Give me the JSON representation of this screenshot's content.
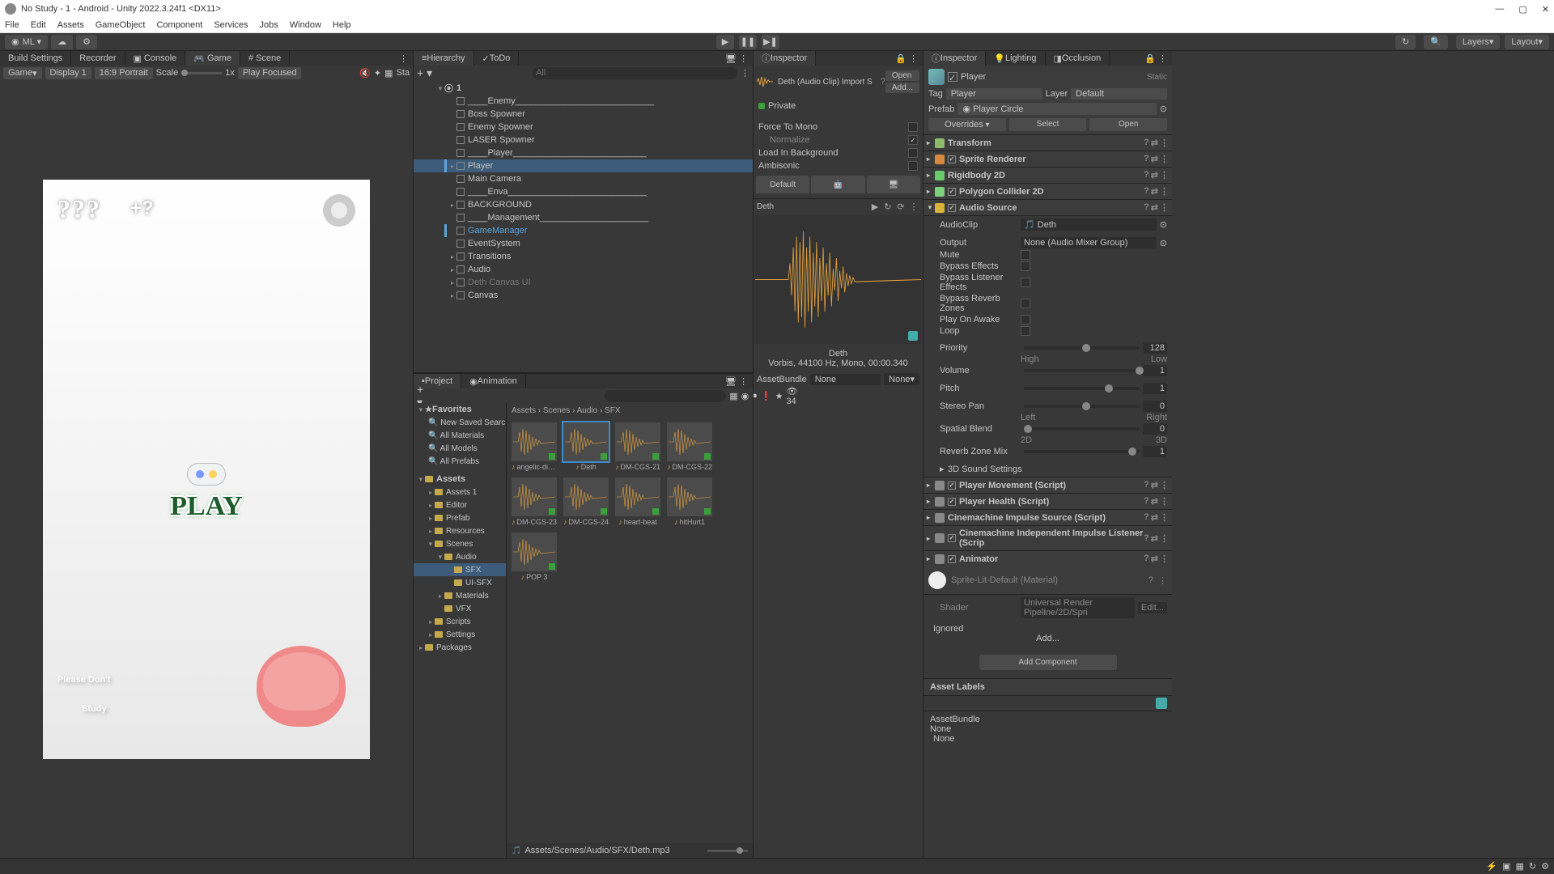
{
  "title": "No Study - 1 - Android - Unity 2022.3.24f1 <DX11>",
  "menu": [
    "File",
    "Edit",
    "Assets",
    "GameObject",
    "Component",
    "Services",
    "Jobs",
    "Window",
    "Help"
  ],
  "toolbar": {
    "account": "ML ▾",
    "layers": "Layers",
    "layout": "Layout"
  },
  "tabs_left": {
    "build": "Build Settings",
    "recorder": "Recorder",
    "console": "Console",
    "game": "Game",
    "scene": "Scene"
  },
  "game_bar": {
    "game": "Game",
    "display": "Display 1",
    "aspect": "16:9 Portrait",
    "scale_label": "Scale",
    "scale_val": "1x",
    "playfocused": "Play Focused",
    "stats": "Sta"
  },
  "game_overlay": {
    "question": "???",
    "plus": "+?",
    "play": "PLAY",
    "tag1": "Please Don't",
    "tag2": "Study"
  },
  "hierarchy": {
    "tab_h": "Hierarchy",
    "tab_todo": "ToDo",
    "search_ph": "All",
    "scene": "1",
    "items": [
      {
        "name": "____Enemy____________________________",
        "indent": 1
      },
      {
        "name": "Boss Spowner",
        "indent": 1
      },
      {
        "name": "Enemy Spowner",
        "indent": 1
      },
      {
        "name": "LASER Spowner",
        "indent": 1
      },
      {
        "name": "____Player___________________________",
        "indent": 1
      },
      {
        "name": "Player",
        "indent": 1,
        "sel": true,
        "arrow": true,
        "bar": true
      },
      {
        "name": "Main Camera",
        "indent": 1
      },
      {
        "name": "____Enva____________________________",
        "indent": 1
      },
      {
        "name": "BACKGROUND",
        "indent": 1,
        "arrow": true
      },
      {
        "name": "____Management______________________",
        "indent": 1
      },
      {
        "name": "GameManager",
        "indent": 1,
        "highlight": true,
        "bar": true
      },
      {
        "name": "EventSystem",
        "indent": 1
      },
      {
        "name": "Transitions",
        "indent": 1,
        "arrow": true
      },
      {
        "name": "Audio",
        "indent": 1,
        "arrow": true
      },
      {
        "name": "Deth Canvas UI",
        "indent": 1,
        "arrow": true,
        "dim": true
      },
      {
        "name": "Canvas",
        "indent": 1,
        "arrow": true
      }
    ]
  },
  "audioimport": {
    "tab": "Inspector",
    "title": "Deth (Audio Clip) Import S",
    "open": "Open",
    "add": "Add...",
    "private": "Private",
    "force": "Force To Mono",
    "normalize": "Normalize",
    "loadbg": "Load In Background",
    "ambisonic": "Ambisonic",
    "default": "Default",
    "preview_name": "Deth",
    "info_name": "Deth",
    "info_fmt": "Vorbis, 44100 Hz, Mono, 00:00.340",
    "ab_label": "AssetBundle",
    "ab_none": "None",
    "ab_none2": "None▾"
  },
  "inspector": {
    "tab_i": "Inspector",
    "tab_l": "Lighting",
    "tab_o": "Occlusion",
    "name": "Player",
    "static": "Static",
    "tag_label": "Tag",
    "tag": "Player",
    "layer_label": "Layer",
    "layer": "Default",
    "prefab_label": "Prefab",
    "prefab": "Player Circle",
    "overrides": "Overrides",
    "select": "Select",
    "openp": "Open",
    "comps": [
      {
        "name": "Transform",
        "color": "#8fb96b"
      },
      {
        "name": "Sprite Renderer",
        "color": "#d8883a",
        "check": true
      },
      {
        "name": "Rigidbody 2D",
        "color": "#6aca6a"
      },
      {
        "name": "Polygon Collider 2D",
        "color": "#7dd07d",
        "check": true
      },
      {
        "name": "Audio Source",
        "color": "#d8b33a",
        "check": true,
        "open": true
      }
    ],
    "audio": {
      "clip_label": "AudioClip",
      "clip": "Deth",
      "output_label": "Output",
      "output": "None (Audio Mixer Group)",
      "mute": "Mute",
      "bypass_fx": "Bypass Effects",
      "bypass_lfx": "Bypass Listener Effects",
      "bypass_rz": "Bypass Reverb Zones",
      "play_awake": "Play On Awake",
      "loop": "Loop",
      "priority_label": "Priority",
      "priority": "128",
      "priority_lo": "High",
      "priority_hi": "Low",
      "volume_label": "Volume",
      "volume": "1",
      "pitch_label": "Pitch",
      "pitch": "1",
      "stereo_label": "Stereo Pan",
      "stereo": "0",
      "stereo_lo": "Left",
      "stereo_hi": "Right",
      "spatial_label": "Spatial Blend",
      "spatial": "0",
      "spatial_lo": "2D",
      "spatial_hi": "3D",
      "reverb_label": "Reverb Zone Mix",
      "reverb": "1",
      "d3": "3D Sound Settings"
    },
    "comps2": [
      {
        "name": "Player Movement (Script)",
        "check": true
      },
      {
        "name": "Player Health (Script)",
        "check": true
      },
      {
        "name": "Cinemachine Impulse Source (Script)"
      },
      {
        "name": "Cinemachine Independent Impulse Listener (Scrip",
        "check": true
      },
      {
        "name": "Animator",
        "check": true
      }
    ],
    "material": "Sprite-Lit-Default (Material)",
    "shader_label": "Shader",
    "shader": "Universal Render Pipeline/2D/Spri",
    "edit": "Edit...",
    "ignored": "Ignored",
    "addbtn": "Add...",
    "addcomp": "Add Component",
    "asset_labels": "Asset Labels",
    "ab_label": "AssetBundle",
    "ab_none": "None",
    "ab_none2": "None"
  },
  "project": {
    "tab_p": "Project",
    "tab_a": "Animation",
    "count": "34",
    "favorites": "Favorites",
    "fav_items": [
      "New Saved Searc",
      "All Materials",
      "All Models",
      "All Prefabs"
    ],
    "assets": "Assets",
    "tree": [
      {
        "name": "Assets 1",
        "indent": 1,
        "arrow": true
      },
      {
        "name": "Editor",
        "indent": 1,
        "arrow": true
      },
      {
        "name": "Prefab",
        "indent": 1,
        "arrow": true
      },
      {
        "name": "Resources",
        "indent": 1,
        "arrow": true
      },
      {
        "name": "Scenes",
        "indent": 1,
        "arrow": true,
        "open": true
      },
      {
        "name": "Audio",
        "indent": 2,
        "arrow": true,
        "open": true
      },
      {
        "name": "SFX",
        "indent": 3,
        "sel": true
      },
      {
        "name": "UI-SFX",
        "indent": 3
      },
      {
        "name": "Materials",
        "indent": 2,
        "arrow": true
      },
      {
        "name": "VFX",
        "indent": 2
      },
      {
        "name": "Scripts",
        "indent": 1,
        "arrow": true
      },
      {
        "name": "Settings",
        "indent": 1,
        "arrow": true
      },
      {
        "name": "Packages",
        "indent": 0,
        "arrow": true
      }
    ],
    "breadcrumb": "Assets  ›  Scenes  ›  Audio  ›  SFX",
    "assets_list": [
      {
        "name": "angelic-dis..."
      },
      {
        "name": "Deth",
        "sel": true
      },
      {
        "name": "DM-CGS-21"
      },
      {
        "name": "DM-CGS-22"
      },
      {
        "name": "DM-CGS-23"
      },
      {
        "name": "DM-CGS-24"
      },
      {
        "name": "heart-beat"
      },
      {
        "name": "hitHurt1"
      },
      {
        "name": "POP 3"
      }
    ],
    "path": "Assets/Scenes/Audio/SFX/Deth.mp3"
  }
}
